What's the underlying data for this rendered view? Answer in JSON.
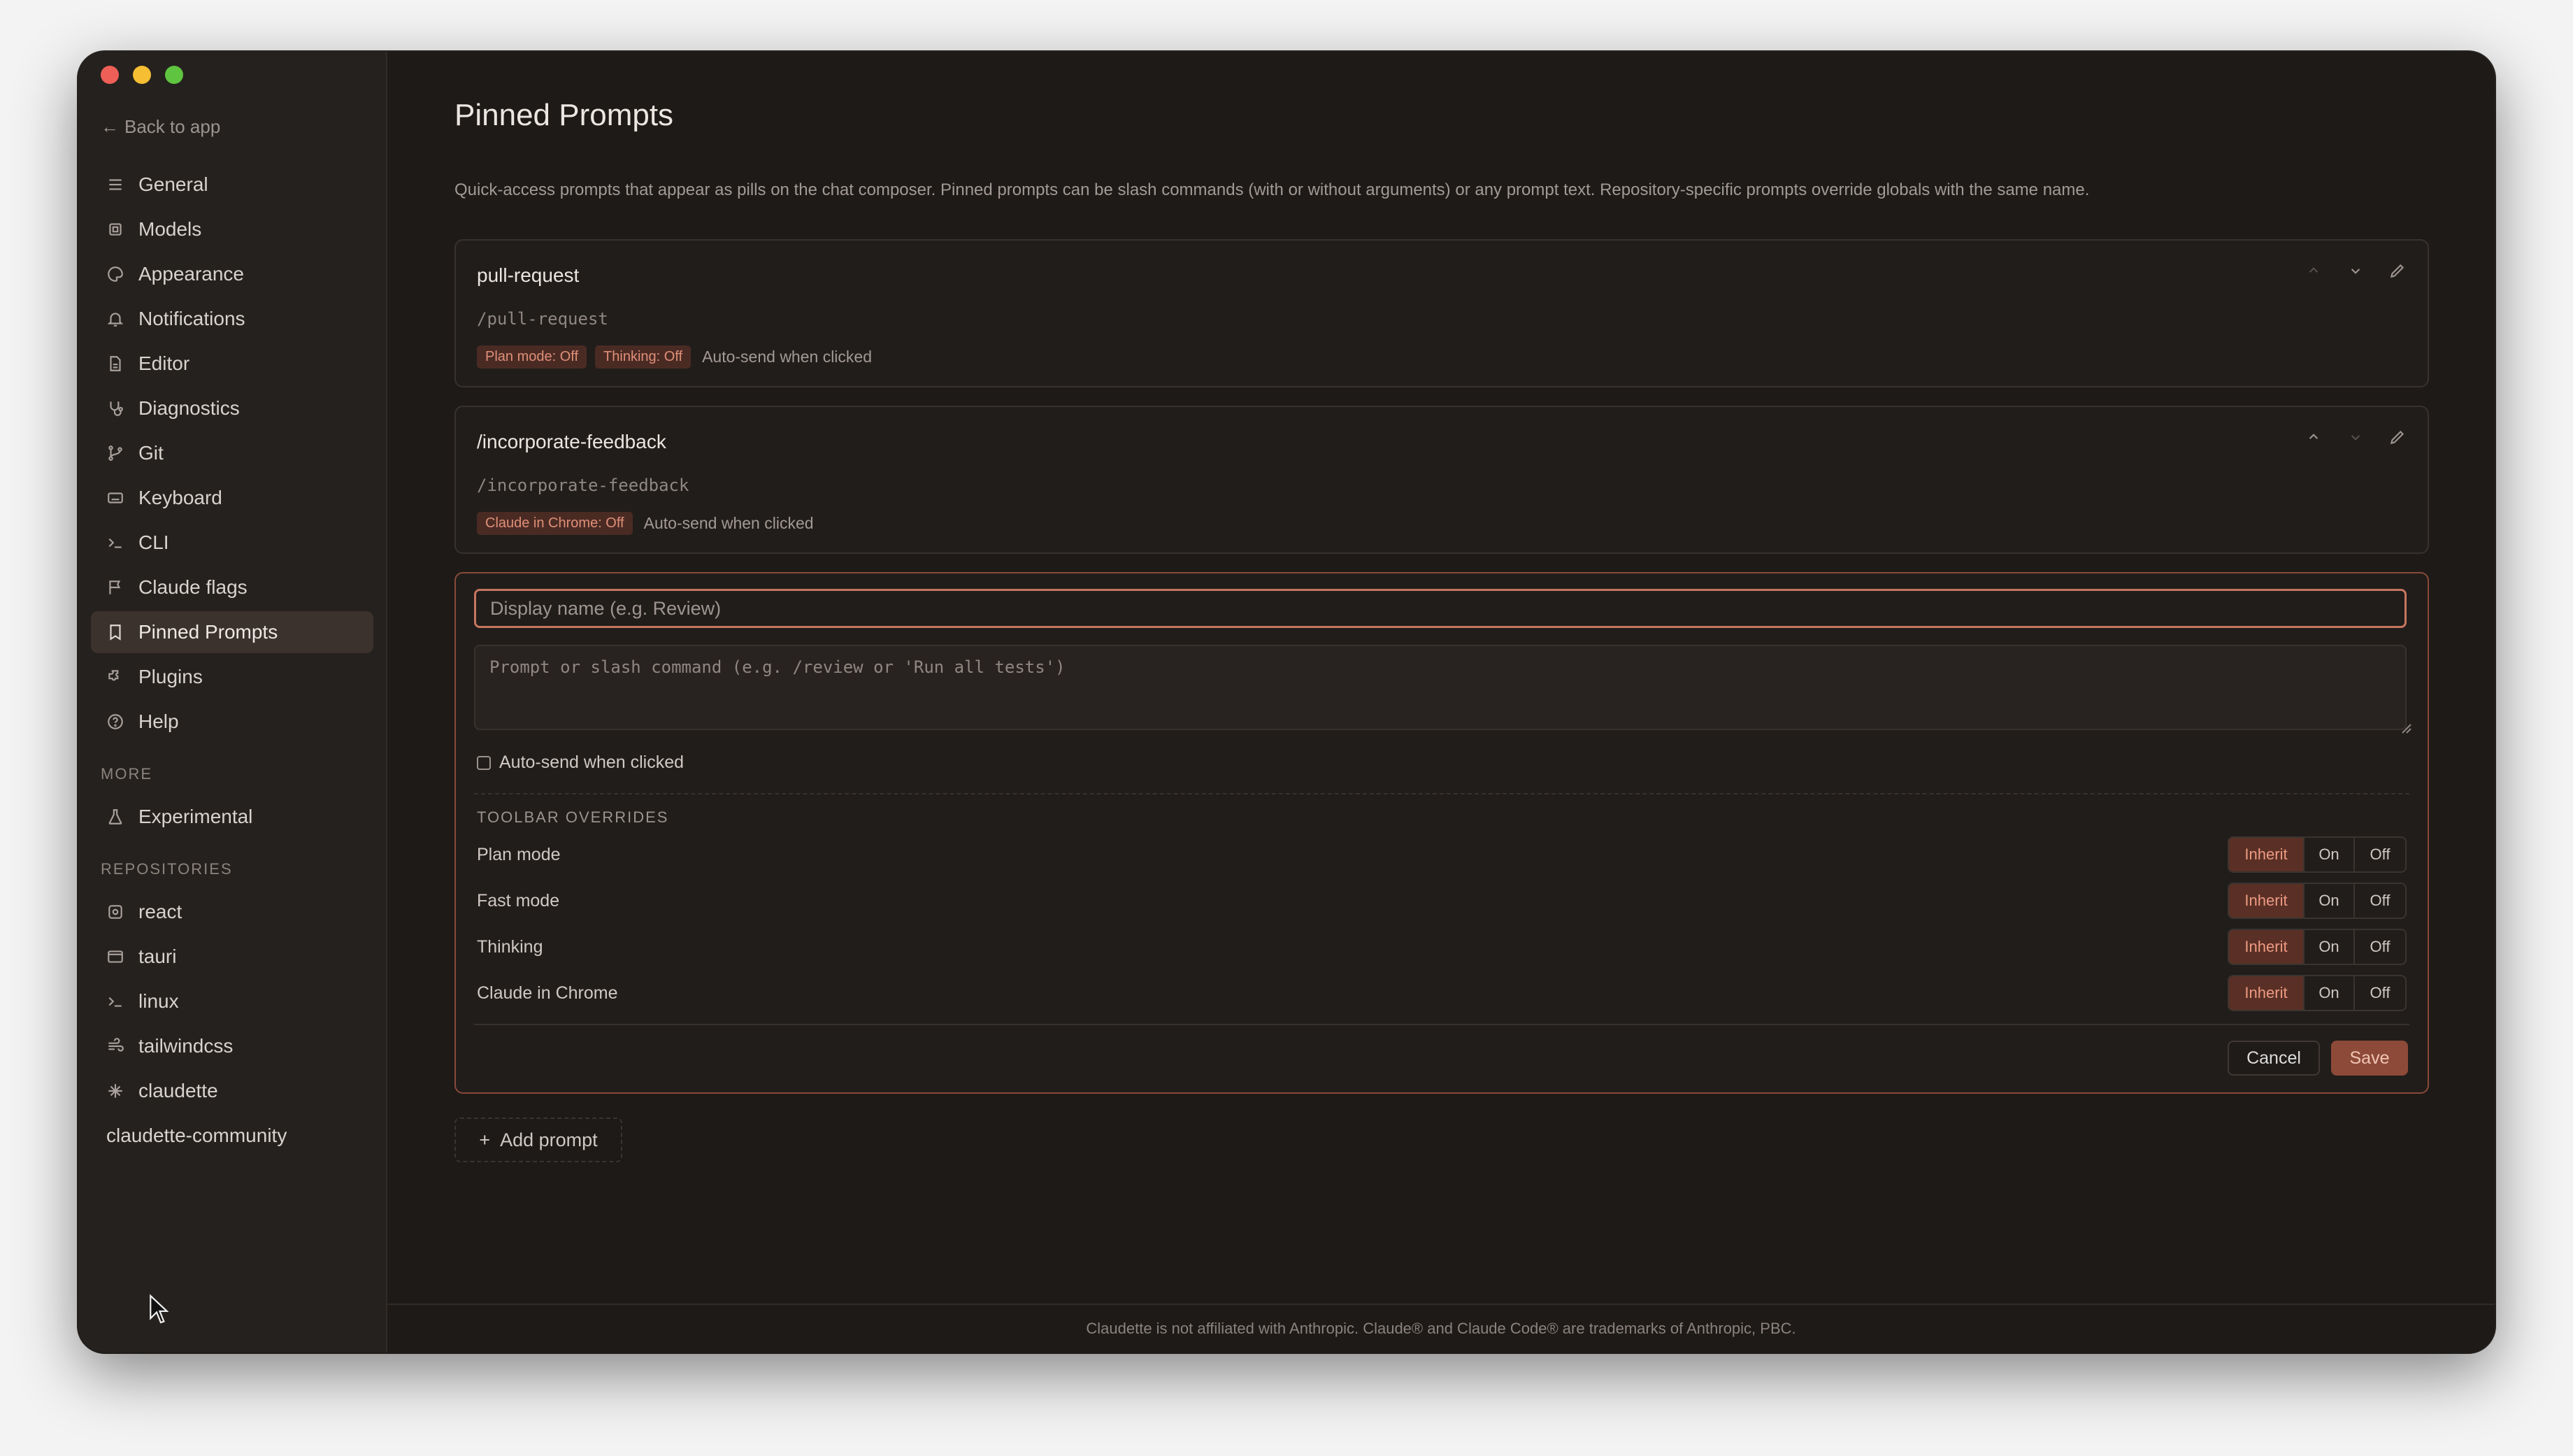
{
  "sidebar": {
    "back_label": "Back to app",
    "nav_items": [
      {
        "label": "General",
        "icon": "sliders-icon"
      },
      {
        "label": "Models",
        "icon": "cpu-icon"
      },
      {
        "label": "Appearance",
        "icon": "palette-icon"
      },
      {
        "label": "Notifications",
        "icon": "bell-icon"
      },
      {
        "label": "Editor",
        "icon": "file-icon"
      },
      {
        "label": "Diagnostics",
        "icon": "stethoscope-icon"
      },
      {
        "label": "Git",
        "icon": "git-branch-icon"
      },
      {
        "label": "Keyboard",
        "icon": "keyboard-icon"
      },
      {
        "label": "CLI",
        "icon": "terminal-icon"
      },
      {
        "label": "Claude flags",
        "icon": "flag-icon"
      },
      {
        "label": "Pinned Prompts",
        "icon": "bookmark-icon",
        "active": true
      },
      {
        "label": "Plugins",
        "icon": "puzzle-icon"
      },
      {
        "label": "Help",
        "icon": "help-circle-icon"
      }
    ],
    "more_label": "MORE",
    "more_items": [
      {
        "label": "Experimental",
        "icon": "flask-icon"
      }
    ],
    "repositories_label": "REPOSITORIES",
    "repositories": [
      {
        "label": "react",
        "icon": "atom-icon"
      },
      {
        "label": "tauri",
        "icon": "window-icon"
      },
      {
        "label": "linux",
        "icon": "terminal-icon"
      },
      {
        "label": "tailwindcss",
        "icon": "wind-icon"
      },
      {
        "label": "claudette",
        "icon": "sparkle-icon"
      },
      {
        "label": "claudette-community",
        "icon": ""
      }
    ]
  },
  "main": {
    "title": "Pinned Prompts",
    "description": "Quick-access prompts that appear as pills on the chat composer. Pinned prompts can be slash commands (with or without arguments) or any prompt text. Repository-specific prompts override globals with the same name.",
    "prompts": [
      {
        "name": "pull-request",
        "command": "/pull-request",
        "tags": [
          "Plan mode: Off",
          "Thinking: Off"
        ],
        "note": "Auto-send when clicked"
      },
      {
        "name": "/incorporate-feedback",
        "command": "/incorporate-feedback",
        "tags": [
          "Claude in Chrome: Off"
        ],
        "note": "Auto-send when clicked"
      }
    ],
    "editor": {
      "name_placeholder": "Display name (e.g. Review)",
      "prompt_placeholder": "Prompt or slash command (e.g. /review or 'Run all tests')",
      "autosend_label": "Auto-send when clicked",
      "overrides_label": "TOOLBAR OVERRIDES",
      "overrides": [
        {
          "label": "Plan mode",
          "selected": "Inherit"
        },
        {
          "label": "Fast mode",
          "selected": "Inherit"
        },
        {
          "label": "Thinking",
          "selected": "Inherit"
        },
        {
          "label": "Claude in Chrome",
          "selected": "Inherit"
        }
      ],
      "options": [
        "Inherit",
        "On",
        "Off"
      ],
      "cancel_label": "Cancel",
      "save_label": "Save"
    },
    "add_prompt_label": "Add prompt",
    "footer": "Claudette is not affiliated with Anthropic. Claude® and Claude Code® are trademarks of Anthropic, PBC."
  },
  "colors": {
    "accent": "#c6765f",
    "tag_bg": "#4a2b24",
    "save_bg": "#8e4a38",
    "background": "#1d1a18",
    "sidebar": "#25211e"
  }
}
